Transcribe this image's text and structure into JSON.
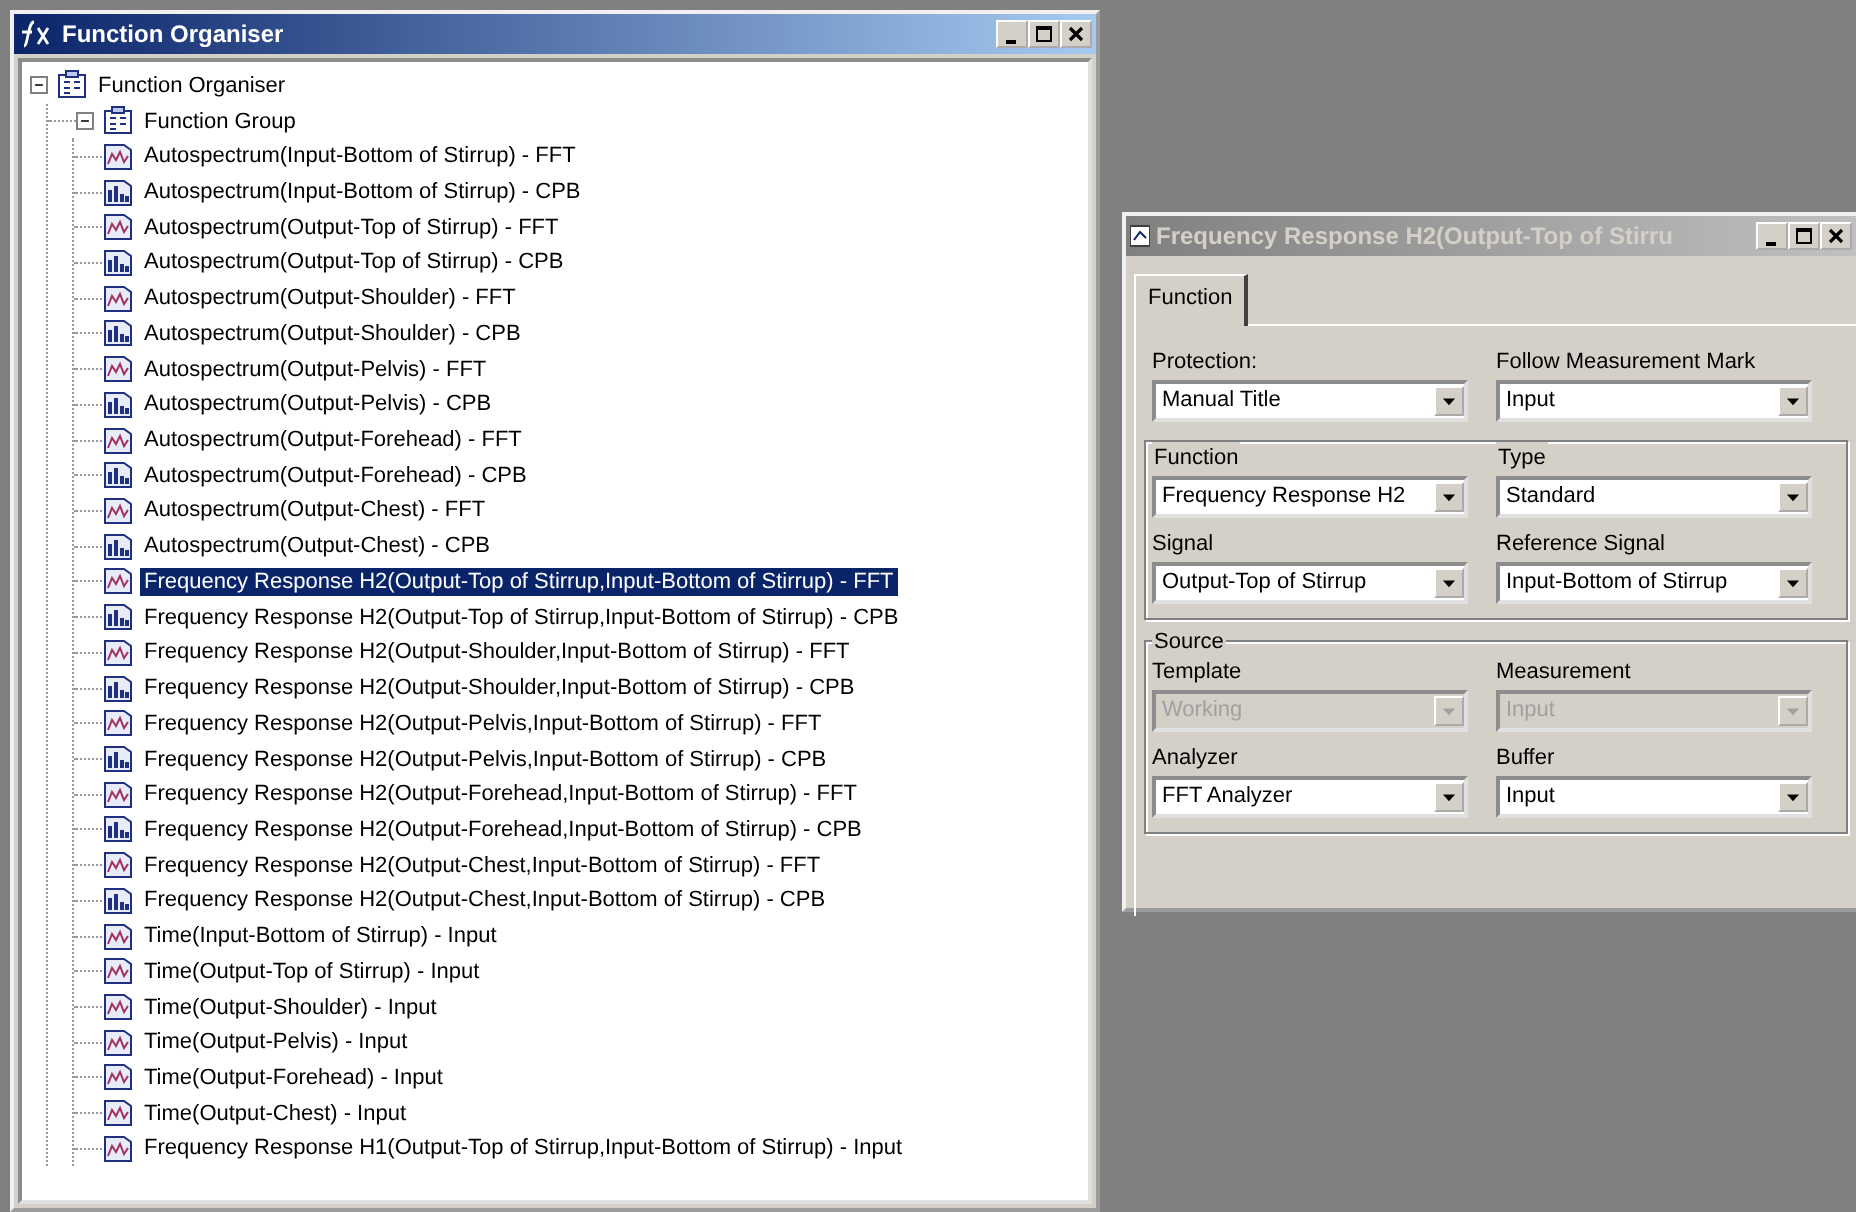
{
  "organiser_window": {
    "title": "Function Organiser"
  },
  "tree": {
    "label": "Function Organiser",
    "expanded": true,
    "children": [
      {
        "label": "Function Group",
        "expanded": true,
        "children": [
          {
            "label": "Autospectrum(Input-Bottom of Stirrup) - FFT",
            "kind": "wave",
            "selected": false
          },
          {
            "label": "Autospectrum(Input-Bottom of Stirrup) - CPB",
            "kind": "bars",
            "selected": false
          },
          {
            "label": "Autospectrum(Output-Top of Stirrup) - FFT",
            "kind": "wave",
            "selected": false
          },
          {
            "label": "Autospectrum(Output-Top of Stirrup) - CPB",
            "kind": "bars",
            "selected": false
          },
          {
            "label": "Autospectrum(Output-Shoulder) - FFT",
            "kind": "wave",
            "selected": false
          },
          {
            "label": "Autospectrum(Output-Shoulder) - CPB",
            "kind": "bars",
            "selected": false
          },
          {
            "label": "Autospectrum(Output-Pelvis) - FFT",
            "kind": "wave",
            "selected": false
          },
          {
            "label": "Autospectrum(Output-Pelvis) - CPB",
            "kind": "bars",
            "selected": false
          },
          {
            "label": "Autospectrum(Output-Forehead) - FFT",
            "kind": "wave",
            "selected": false
          },
          {
            "label": "Autospectrum(Output-Forehead) - CPB",
            "kind": "bars",
            "selected": false
          },
          {
            "label": "Autospectrum(Output-Chest) - FFT",
            "kind": "wave",
            "selected": false
          },
          {
            "label": "Autospectrum(Output-Chest) - CPB",
            "kind": "bars",
            "selected": false
          },
          {
            "label": "Frequency Response H2(Output-Top of Stirrup,Input-Bottom of Stirrup) - FFT",
            "kind": "wave",
            "selected": true
          },
          {
            "label": "Frequency Response H2(Output-Top of Stirrup,Input-Bottom of Stirrup) - CPB",
            "kind": "bars",
            "selected": false
          },
          {
            "label": "Frequency Response H2(Output-Shoulder,Input-Bottom of Stirrup) - FFT",
            "kind": "wave",
            "selected": false
          },
          {
            "label": "Frequency Response H2(Output-Shoulder,Input-Bottom of Stirrup) - CPB",
            "kind": "bars",
            "selected": false
          },
          {
            "label": "Frequency Response H2(Output-Pelvis,Input-Bottom of Stirrup) - FFT",
            "kind": "wave",
            "selected": false
          },
          {
            "label": "Frequency Response H2(Output-Pelvis,Input-Bottom of Stirrup) - CPB",
            "kind": "bars",
            "selected": false
          },
          {
            "label": "Frequency Response H2(Output-Forehead,Input-Bottom of Stirrup) - FFT",
            "kind": "wave",
            "selected": false
          },
          {
            "label": "Frequency Response H2(Output-Forehead,Input-Bottom of Stirrup) - CPB",
            "kind": "bars",
            "selected": false
          },
          {
            "label": "Frequency Response H2(Output-Chest,Input-Bottom of Stirrup) - FFT",
            "kind": "wave",
            "selected": false
          },
          {
            "label": "Frequency Response H2(Output-Chest,Input-Bottom of Stirrup) - CPB",
            "kind": "bars",
            "selected": false
          },
          {
            "label": "Time(Input-Bottom of Stirrup) - Input",
            "kind": "wave",
            "selected": false
          },
          {
            "label": "Time(Output-Top of Stirrup) - Input",
            "kind": "wave",
            "selected": false
          },
          {
            "label": "Time(Output-Shoulder) - Input",
            "kind": "wave",
            "selected": false
          },
          {
            "label": "Time(Output-Pelvis) - Input",
            "kind": "wave",
            "selected": false
          },
          {
            "label": "Time(Output-Forehead) - Input",
            "kind": "wave",
            "selected": false
          },
          {
            "label": "Time(Output-Chest) - Input",
            "kind": "wave",
            "selected": false
          },
          {
            "label": "Frequency Response H1(Output-Top of Stirrup,Input-Bottom of Stirrup) - Input",
            "kind": "wave",
            "selected": false
          }
        ]
      }
    ]
  },
  "dialog": {
    "title": "Frequency Response H2(Output-Top of Stirru",
    "tabs": [
      {
        "label": "Function",
        "selected": true
      }
    ],
    "sections": [
      {
        "kind": "plain",
        "fields": [
          {
            "label": "Protection:",
            "value": "Manual Title",
            "disabled": false
          },
          {
            "label": "Follow Measurement Mark",
            "value": "Input",
            "disabled": false
          }
        ]
      },
      {
        "kind": "group",
        "fields": [
          {
            "label": "Function",
            "value": "Frequency Response H2",
            "disabled": false
          },
          {
            "label": "Type",
            "value": "Standard",
            "disabled": false
          },
          {
            "label": "Signal",
            "value": "Output-Top of Stirrup",
            "disabled": false
          },
          {
            "label": "Reference Signal",
            "value": "Input-Bottom of Stirrup",
            "disabled": false
          }
        ]
      },
      {
        "kind": "group",
        "legend": "Source",
        "fields": [
          {
            "label": "Template",
            "value": "Working",
            "disabled": true
          },
          {
            "label": "Measurement",
            "value": "Input",
            "disabled": true
          },
          {
            "label": "Analyzer",
            "value": "FFT Analyzer",
            "disabled": false
          },
          {
            "label": "Buffer",
            "value": "Input",
            "disabled": false
          }
        ]
      }
    ]
  }
}
